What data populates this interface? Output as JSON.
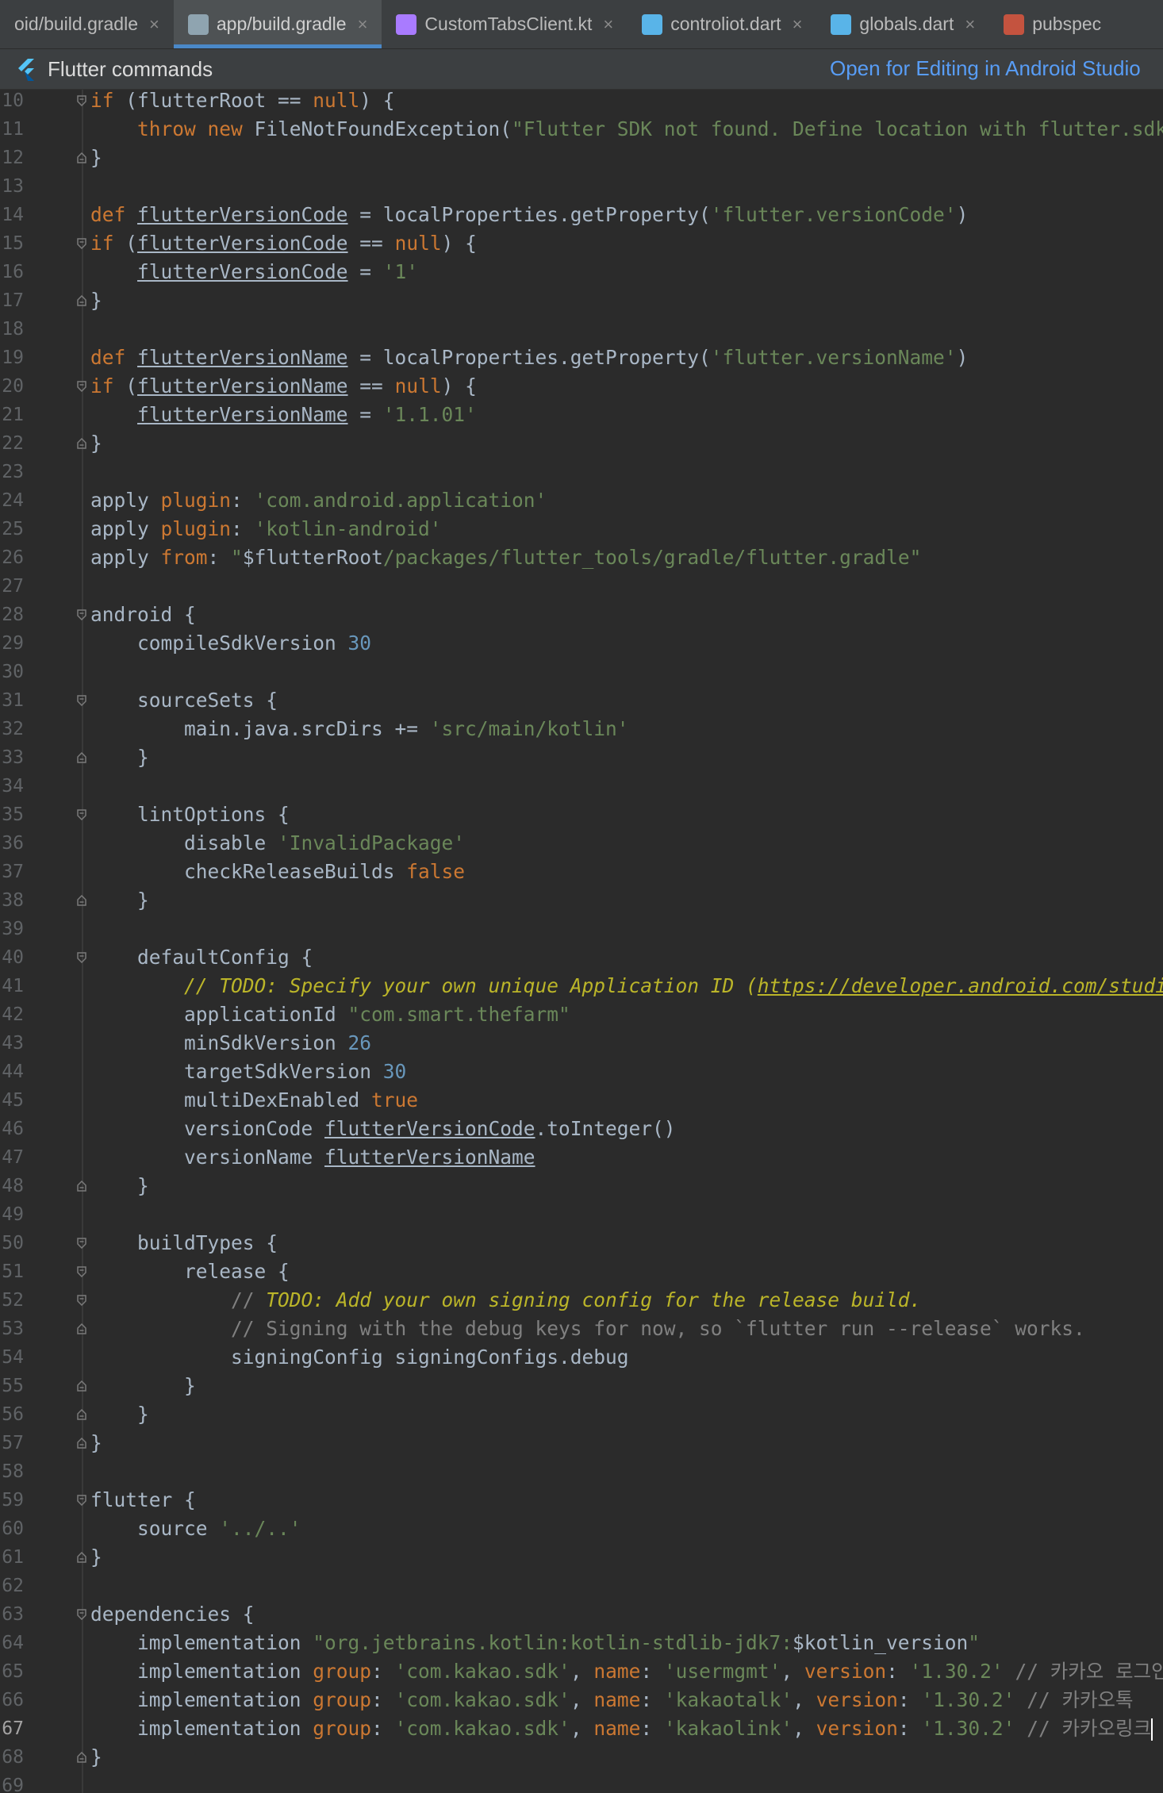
{
  "tabs": [
    {
      "label": "oid/build.gradle",
      "icon": "gradle-icon",
      "active": false,
      "icon_color": "#3c3f41"
    },
    {
      "label": "app/build.gradle",
      "icon": "gradle-elephant-icon",
      "active": true,
      "icon_color": "#8fa4b0"
    },
    {
      "label": "CustomTabsClient.kt",
      "icon": "kotlin-file-icon",
      "active": false,
      "icon_color": "#a97bff"
    },
    {
      "label": "controliot.dart",
      "icon": "dart-file-icon",
      "active": false,
      "icon_color": "#59b4e8"
    },
    {
      "label": "globals.dart",
      "icon": "dart-file-icon",
      "active": false,
      "icon_color": "#59b4e8"
    },
    {
      "label": "pubspec",
      "icon": "yaml-file-icon",
      "active": false,
      "icon_color": "#c4533f"
    }
  ],
  "toolbar": {
    "title": "Flutter commands",
    "open_link": "Open for Editing in Android Studio"
  },
  "current_line": 67,
  "lines": [
    {
      "n": 10,
      "fold": "open",
      "segs": [
        [
          "kw",
          "if "
        ],
        [
          "plain",
          "(flutterRoot == "
        ],
        [
          "kw",
          "null"
        ],
        [
          "plain",
          ") {"
        ]
      ]
    },
    {
      "n": 11,
      "fold": "",
      "segs": [
        [
          "plain",
          "    "
        ],
        [
          "kw",
          "throw new "
        ],
        [
          "plain",
          "FileNotFoundException("
        ],
        [
          "str",
          "\"Flutter SDK not found. Define location with flutter.sdk in the local.properties file.\""
        ],
        [
          "plain",
          ")"
        ]
      ]
    },
    {
      "n": 12,
      "fold": "close",
      "segs": [
        [
          "plain",
          "}"
        ]
      ]
    },
    {
      "n": 13,
      "fold": "",
      "segs": []
    },
    {
      "n": 14,
      "fold": "",
      "segs": [
        [
          "kw",
          "def "
        ],
        [
          "ul",
          "flutterVersionCode"
        ],
        [
          "plain",
          " = localProperties.getProperty("
        ],
        [
          "str",
          "'flutter.versionCode'"
        ],
        [
          "plain",
          ")"
        ]
      ]
    },
    {
      "n": 15,
      "fold": "open",
      "segs": [
        [
          "kw",
          "if "
        ],
        [
          "plain",
          "("
        ],
        [
          "ul",
          "flutterVersionCode"
        ],
        [
          "plain",
          " == "
        ],
        [
          "kw",
          "null"
        ],
        [
          "plain",
          ") {"
        ]
      ]
    },
    {
      "n": 16,
      "fold": "",
      "segs": [
        [
          "plain",
          "    "
        ],
        [
          "ul",
          "flutterVersionCode"
        ],
        [
          "plain",
          " = "
        ],
        [
          "str",
          "'1'"
        ]
      ]
    },
    {
      "n": 17,
      "fold": "close",
      "segs": [
        [
          "plain",
          "}"
        ]
      ]
    },
    {
      "n": 18,
      "fold": "",
      "segs": []
    },
    {
      "n": 19,
      "fold": "",
      "segs": [
        [
          "kw",
          "def "
        ],
        [
          "ul",
          "flutterVersionName"
        ],
        [
          "plain",
          " = localProperties.getProperty("
        ],
        [
          "str",
          "'flutter.versionName'"
        ],
        [
          "plain",
          ")"
        ]
      ]
    },
    {
      "n": 20,
      "fold": "open",
      "segs": [
        [
          "kw",
          "if "
        ],
        [
          "plain",
          "("
        ],
        [
          "ul",
          "flutterVersionName"
        ],
        [
          "plain",
          " == "
        ],
        [
          "kw",
          "null"
        ],
        [
          "plain",
          ") {"
        ]
      ]
    },
    {
      "n": 21,
      "fold": "",
      "segs": [
        [
          "plain",
          "    "
        ],
        [
          "ul",
          "flutterVersionName"
        ],
        [
          "plain",
          " = "
        ],
        [
          "str",
          "'1.1.01'"
        ]
      ]
    },
    {
      "n": 22,
      "fold": "close",
      "segs": [
        [
          "plain",
          "}"
        ]
      ]
    },
    {
      "n": 23,
      "fold": "",
      "segs": []
    },
    {
      "n": 24,
      "fold": "",
      "segs": [
        [
          "plain",
          "apply "
        ],
        [
          "kw",
          "plugin"
        ],
        [
          "plain",
          ": "
        ],
        [
          "str",
          "'com.android.application'"
        ]
      ]
    },
    {
      "n": 25,
      "fold": "",
      "segs": [
        [
          "plain",
          "apply "
        ],
        [
          "kw",
          "plugin"
        ],
        [
          "plain",
          ": "
        ],
        [
          "str",
          "'kotlin-android'"
        ]
      ]
    },
    {
      "n": 26,
      "fold": "",
      "segs": [
        [
          "plain",
          "apply "
        ],
        [
          "kw",
          "from"
        ],
        [
          "plain",
          ": "
        ],
        [
          "str",
          "\""
        ],
        [
          "plain",
          "$flutterRoot"
        ],
        [
          "str",
          "/packages/flutter_tools/gradle/flutter.gradle\""
        ]
      ]
    },
    {
      "n": 27,
      "fold": "",
      "segs": []
    },
    {
      "n": 28,
      "fold": "open",
      "segs": [
        [
          "plain",
          "android {"
        ]
      ]
    },
    {
      "n": 29,
      "fold": "",
      "segs": [
        [
          "plain",
          "    compileSdkVersion "
        ],
        [
          "num",
          "30"
        ]
      ]
    },
    {
      "n": 30,
      "fold": "",
      "segs": []
    },
    {
      "n": 31,
      "fold": "open",
      "segs": [
        [
          "plain",
          "    sourceSets {"
        ]
      ]
    },
    {
      "n": 32,
      "fold": "",
      "segs": [
        [
          "plain",
          "        main.java.srcDirs += "
        ],
        [
          "str",
          "'src/main/kotlin'"
        ]
      ]
    },
    {
      "n": 33,
      "fold": "close",
      "segs": [
        [
          "plain",
          "    }"
        ]
      ]
    },
    {
      "n": 34,
      "fold": "",
      "segs": []
    },
    {
      "n": 35,
      "fold": "open",
      "segs": [
        [
          "plain",
          "    lintOptions {"
        ]
      ]
    },
    {
      "n": 36,
      "fold": "",
      "segs": [
        [
          "plain",
          "        disable "
        ],
        [
          "str",
          "'InvalidPackage'"
        ]
      ]
    },
    {
      "n": 37,
      "fold": "",
      "segs": [
        [
          "plain",
          "        checkReleaseBuilds "
        ],
        [
          "kw",
          "false"
        ]
      ]
    },
    {
      "n": 38,
      "fold": "close",
      "segs": [
        [
          "plain",
          "    }"
        ]
      ]
    },
    {
      "n": 39,
      "fold": "",
      "segs": []
    },
    {
      "n": 40,
      "fold": "open",
      "segs": [
        [
          "plain",
          "    defaultConfig {"
        ]
      ]
    },
    {
      "n": 41,
      "fold": "",
      "segs": [
        [
          "plain",
          "        "
        ],
        [
          "todo",
          "// TODO: Specify your own unique Application ID ("
        ],
        [
          "todo ul",
          "https://developer.android.com/studio/build/application-id.html"
        ],
        [
          "todo",
          ")."
        ]
      ]
    },
    {
      "n": 42,
      "fold": "",
      "segs": [
        [
          "plain",
          "        applicationId "
        ],
        [
          "str",
          "\"com.smart.thefarm\""
        ]
      ]
    },
    {
      "n": 43,
      "fold": "",
      "segs": [
        [
          "plain",
          "        minSdkVersion "
        ],
        [
          "num",
          "26"
        ]
      ]
    },
    {
      "n": 44,
      "fold": "",
      "segs": [
        [
          "plain",
          "        targetSdkVersion "
        ],
        [
          "num",
          "30"
        ]
      ]
    },
    {
      "n": 45,
      "fold": "",
      "segs": [
        [
          "plain",
          "        multiDexEnabled "
        ],
        [
          "kw",
          "true"
        ]
      ]
    },
    {
      "n": 46,
      "fold": "",
      "segs": [
        [
          "plain",
          "        versionCode "
        ],
        [
          "ul",
          "flutterVersionCode"
        ],
        [
          "plain",
          ".toInteger()"
        ]
      ]
    },
    {
      "n": 47,
      "fold": "",
      "segs": [
        [
          "plain",
          "        versionName "
        ],
        [
          "ul",
          "flutterVersionName"
        ]
      ]
    },
    {
      "n": 48,
      "fold": "close",
      "segs": [
        [
          "plain",
          "    }"
        ]
      ]
    },
    {
      "n": 49,
      "fold": "",
      "segs": []
    },
    {
      "n": 50,
      "fold": "open",
      "segs": [
        [
          "plain",
          "    buildTypes {"
        ]
      ]
    },
    {
      "n": 51,
      "fold": "open",
      "segs": [
        [
          "plain",
          "        release {"
        ]
      ]
    },
    {
      "n": 52,
      "fold": "open",
      "segs": [
        [
          "plain",
          "            "
        ],
        [
          "cm",
          "// "
        ],
        [
          "todo",
          "TODO: Add your own signing config for the release build."
        ]
      ]
    },
    {
      "n": 53,
      "fold": "close",
      "segs": [
        [
          "plain",
          "            "
        ],
        [
          "cm",
          "// Signing with the debug keys for now, so `flutter run --release` works."
        ]
      ]
    },
    {
      "n": 54,
      "fold": "",
      "segs": [
        [
          "plain",
          "            signingConfig signingConfigs.debug"
        ]
      ]
    },
    {
      "n": 55,
      "fold": "close",
      "segs": [
        [
          "plain",
          "        }"
        ]
      ]
    },
    {
      "n": 56,
      "fold": "close",
      "segs": [
        [
          "plain",
          "    }"
        ]
      ]
    },
    {
      "n": 57,
      "fold": "close",
      "segs": [
        [
          "plain",
          "}"
        ]
      ]
    },
    {
      "n": 58,
      "fold": "",
      "segs": []
    },
    {
      "n": 59,
      "fold": "open",
      "segs": [
        [
          "plain",
          "flutter {"
        ]
      ]
    },
    {
      "n": 60,
      "fold": "",
      "segs": [
        [
          "plain",
          "    source "
        ],
        [
          "str",
          "'../..'"
        ]
      ]
    },
    {
      "n": 61,
      "fold": "close",
      "segs": [
        [
          "plain",
          "}"
        ]
      ]
    },
    {
      "n": 62,
      "fold": "",
      "segs": []
    },
    {
      "n": 63,
      "fold": "open",
      "segs": [
        [
          "plain",
          "dependencies {"
        ]
      ]
    },
    {
      "n": 64,
      "fold": "",
      "segs": [
        [
          "plain",
          "    implementation "
        ],
        [
          "str",
          "\"org.jetbrains.kotlin:kotlin-stdlib-jdk7:"
        ],
        [
          "plain",
          "$kotlin_version"
        ],
        [
          "str",
          "\""
        ]
      ]
    },
    {
      "n": 65,
      "fold": "",
      "segs": [
        [
          "plain",
          "    implementation "
        ],
        [
          "kw",
          "group"
        ],
        [
          "plain",
          ": "
        ],
        [
          "str",
          "'com.kakao.sdk'"
        ],
        [
          "plain",
          ", "
        ],
        [
          "kw",
          "name"
        ],
        [
          "plain",
          ": "
        ],
        [
          "str",
          "'usermgmt'"
        ],
        [
          "plain",
          ", "
        ],
        [
          "kw",
          "version"
        ],
        [
          "plain",
          ": "
        ],
        [
          "str",
          "'1.30.2'"
        ],
        [
          "cm",
          " // 카카오 로그인"
        ]
      ]
    },
    {
      "n": 66,
      "fold": "",
      "segs": [
        [
          "plain",
          "    implementation "
        ],
        [
          "kw",
          "group"
        ],
        [
          "plain",
          ": "
        ],
        [
          "str",
          "'com.kakao.sdk'"
        ],
        [
          "plain",
          ", "
        ],
        [
          "kw",
          "name"
        ],
        [
          "plain",
          ": "
        ],
        [
          "str",
          "'kakaotalk'"
        ],
        [
          "plain",
          ", "
        ],
        [
          "kw",
          "version"
        ],
        [
          "plain",
          ": "
        ],
        [
          "str",
          "'1.30.2'"
        ],
        [
          "cm",
          " // 카카오톡"
        ]
      ]
    },
    {
      "n": 67,
      "fold": "",
      "segs": [
        [
          "plain",
          "    implementation "
        ],
        [
          "kw",
          "group"
        ],
        [
          "plain",
          ": "
        ],
        [
          "str",
          "'com.kakao.sdk'"
        ],
        [
          "plain",
          ", "
        ],
        [
          "kw",
          "name"
        ],
        [
          "plain",
          ": "
        ],
        [
          "str",
          "'kakaolink'"
        ],
        [
          "plain",
          ", "
        ],
        [
          "kw",
          "version"
        ],
        [
          "plain",
          ": "
        ],
        [
          "str",
          "'1.30.2'"
        ],
        [
          "cm",
          " // 카카오링크"
        ]
      ]
    },
    {
      "n": 68,
      "fold": "close",
      "segs": [
        [
          "plain",
          "}"
        ]
      ]
    },
    {
      "n": 69,
      "fold": "",
      "segs": []
    }
  ],
  "colors": {
    "keyword": "#cc7832",
    "string": "#6a8759",
    "number": "#6897bb",
    "comment": "#808080",
    "todo": "#bbb529",
    "text": "#a9b7c6",
    "background": "#2b2b2b",
    "accent": "#4a88c7"
  }
}
